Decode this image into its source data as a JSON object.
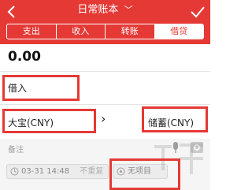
{
  "header": {
    "title": "日常账本",
    "background_color": "#e53935"
  },
  "tabs": [
    {
      "label": "支出",
      "active": false
    },
    {
      "label": "收入",
      "active": false
    },
    {
      "label": "转账",
      "active": false
    },
    {
      "label": "借贷",
      "active": true
    }
  ],
  "amount": "0.00",
  "loan": {
    "type_label": "借入",
    "from_account": "大宝(CNY)",
    "to_account": "储蓄(CNY)"
  },
  "note": {
    "placeholder": "备注"
  },
  "meta": {
    "date_time": "03-31 14:48",
    "repeat_label": "不重复",
    "project_label": "无项目"
  },
  "icons": {
    "back": "back-arrow-icon",
    "check": "check-icon",
    "dropdown": "chevron-down-icon",
    "transfer": "chevron-right-icon",
    "mic": "microphone-icon",
    "camera": "camera-icon",
    "clock": "clock-icon",
    "project": "tag-icon"
  },
  "annotation_color": "#e53935"
}
